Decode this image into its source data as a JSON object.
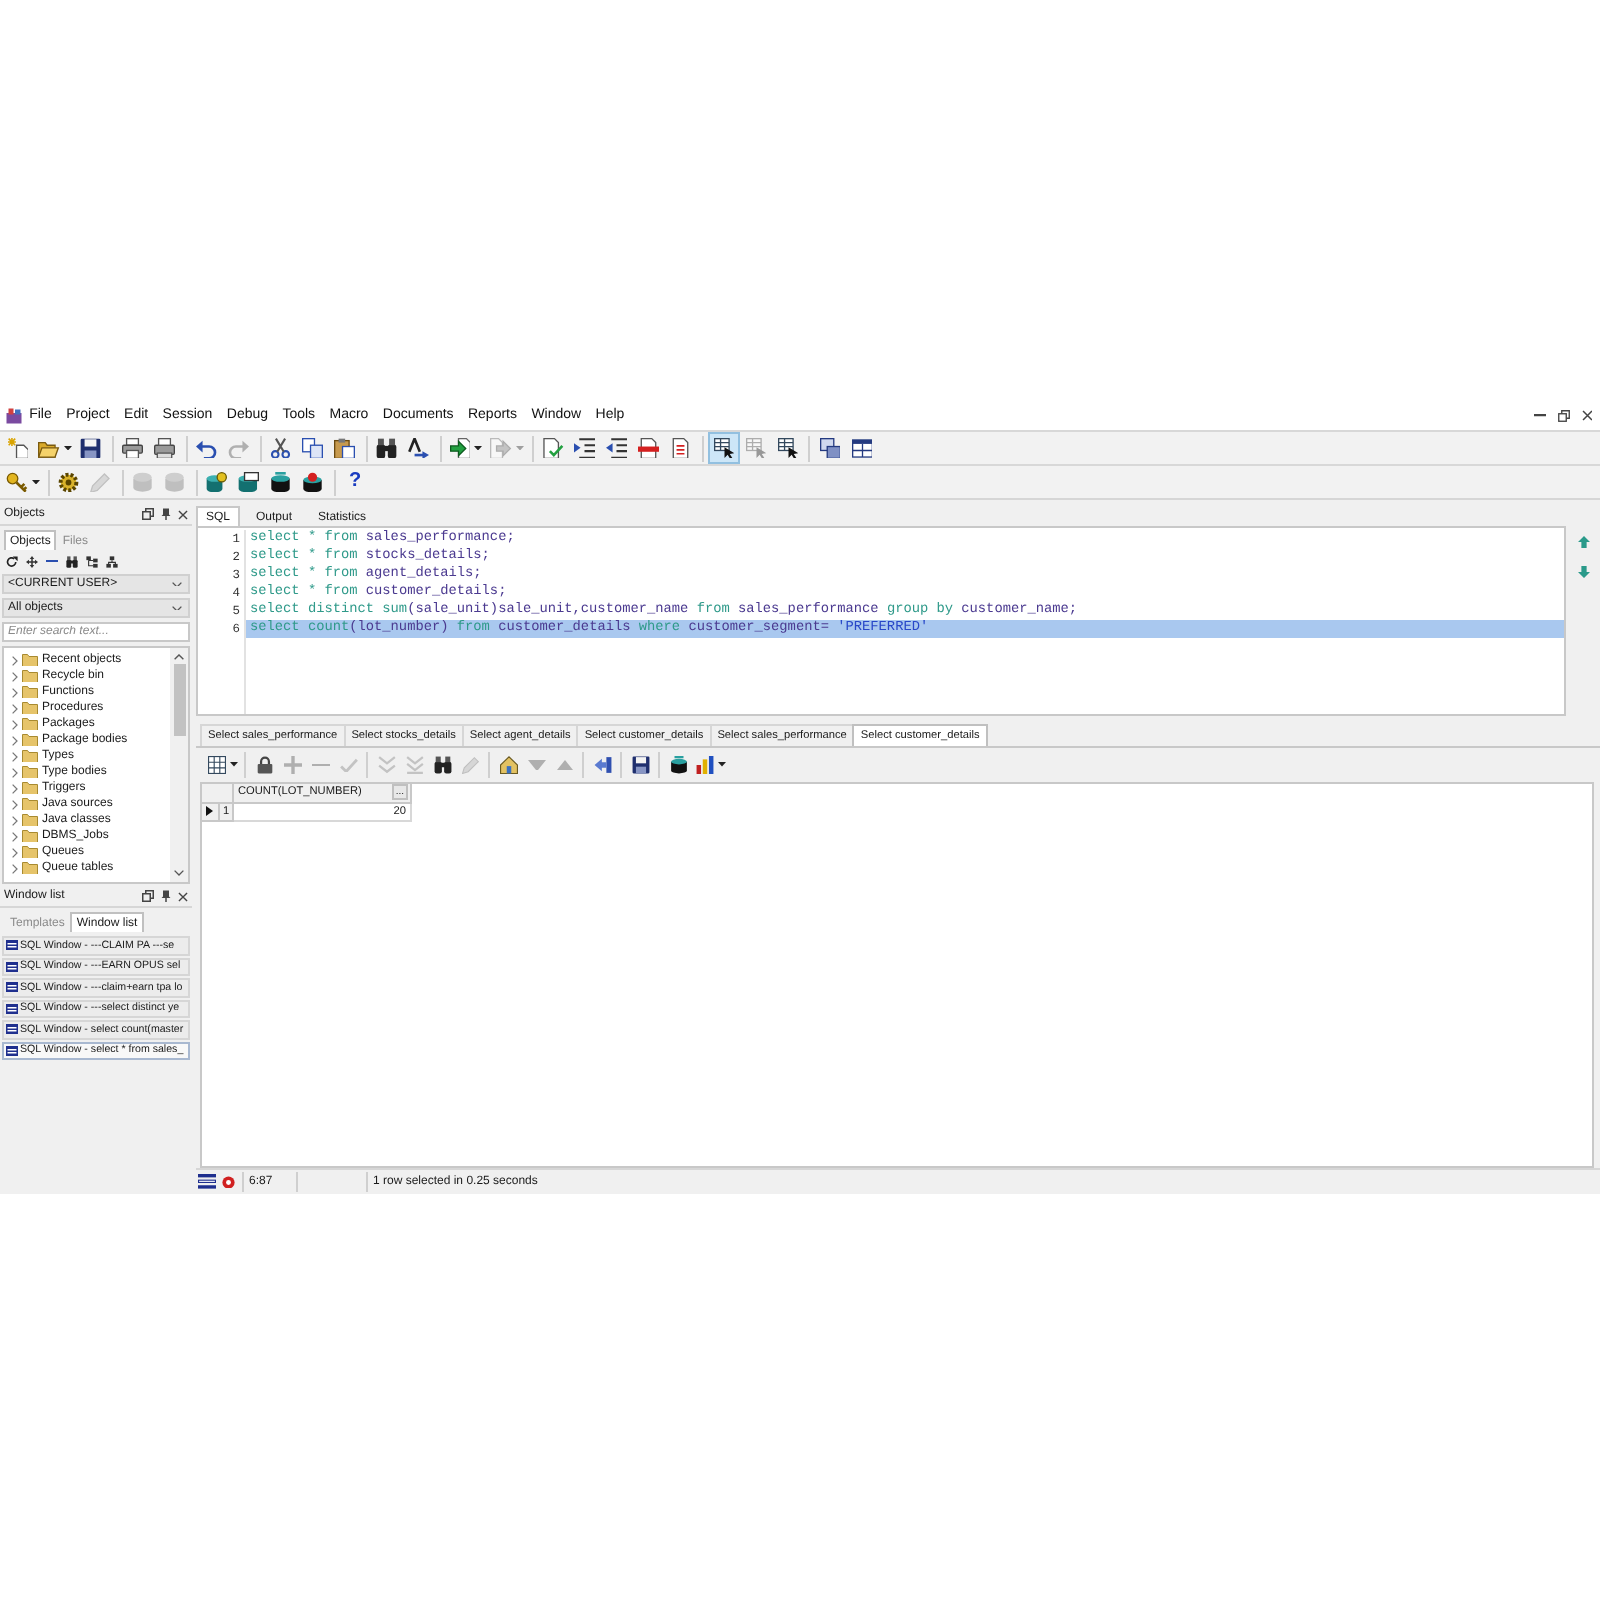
{
  "menu": {
    "items": [
      "File",
      "Project",
      "Edit",
      "Session",
      "Debug",
      "Tools",
      "Macro",
      "Documents",
      "Reports",
      "Window",
      "Help"
    ]
  },
  "toolbar_main": {
    "groups": [
      [
        {
          "kind": "new",
          "disabled": false,
          "dropdown": false,
          "pressed": false
        },
        {
          "kind": "open",
          "disabled": false,
          "dropdown": true,
          "pressed": false
        },
        {
          "kind": "save",
          "disabled": false,
          "dropdown": false,
          "pressed": false
        }
      ],
      [
        {
          "kind": "print",
          "disabled": false,
          "dropdown": false,
          "pressed": false
        },
        {
          "kind": "preview",
          "disabled": false,
          "dropdown": false,
          "pressed": false
        }
      ],
      [
        {
          "kind": "undo",
          "disabled": false,
          "dropdown": false,
          "pressed": false
        },
        {
          "kind": "redo",
          "disabled": true,
          "dropdown": false,
          "pressed": false
        }
      ],
      [
        {
          "kind": "cut",
          "disabled": false,
          "dropdown": false,
          "pressed": false
        },
        {
          "kind": "copy",
          "disabled": false,
          "dropdown": false,
          "pressed": false
        },
        {
          "kind": "paste",
          "disabled": false,
          "dropdown": false,
          "pressed": false
        }
      ],
      [
        {
          "kind": "find",
          "disabled": false,
          "dropdown": false,
          "pressed": false
        },
        {
          "kind": "replace",
          "disabled": false,
          "dropdown": false,
          "pressed": false
        }
      ],
      [
        {
          "kind": "execute",
          "disabled": false,
          "dropdown": true,
          "pressed": false
        },
        {
          "kind": "step",
          "disabled": true,
          "dropdown": true,
          "pressed": false
        }
      ],
      [
        {
          "kind": "verify",
          "disabled": false,
          "dropdown": false,
          "pressed": false
        },
        {
          "kind": "indent",
          "disabled": false,
          "dropdown": false,
          "pressed": false
        },
        {
          "kind": "outdent",
          "disabled": false,
          "dropdown": false,
          "pressed": false
        },
        {
          "kind": "comment",
          "disabled": false,
          "dropdown": false,
          "pressed": false
        },
        {
          "kind": "uncomment",
          "disabled": false,
          "dropdown": false,
          "pressed": false
        }
      ],
      [
        {
          "kind": "pointer",
          "disabled": false,
          "dropdown": false,
          "pressed": true
        },
        {
          "kind": "pointer",
          "disabled": true,
          "dropdown": false,
          "pressed": false
        },
        {
          "kind": "pointer",
          "disabled": false,
          "dropdown": false,
          "pressed": false
        }
      ],
      [
        {
          "kind": "cascade",
          "disabled": false,
          "dropdown": false,
          "pressed": false
        },
        {
          "kind": "tile",
          "disabled": false,
          "dropdown": false,
          "pressed": false
        }
      ]
    ]
  },
  "toolbar_secondary": {
    "groups": [
      [
        {
          "kind": "key",
          "disabled": false,
          "dropdown": true,
          "pressed": false
        }
      ],
      [
        {
          "kind": "gear",
          "disabled": false,
          "dropdown": false,
          "pressed": false
        },
        {
          "kind": "pencil",
          "disabled": true,
          "dropdown": false,
          "pressed": false
        }
      ],
      [
        {
          "kind": "commit",
          "disabled": true,
          "dropdown": false,
          "pressed": false
        },
        {
          "kind": "commit",
          "disabled": true,
          "dropdown": false,
          "pressed": false
        }
      ],
      [
        {
          "kind": "dbuser",
          "disabled": false,
          "dropdown": false,
          "pressed": false
        },
        {
          "kind": "dblist",
          "disabled": false,
          "dropdown": false,
          "pressed": false
        },
        {
          "kind": "dbplain",
          "disabled": false,
          "dropdown": false,
          "pressed": false
        },
        {
          "kind": "dbred",
          "disabled": false,
          "dropdown": false,
          "pressed": false
        }
      ],
      [
        {
          "kind": "help",
          "label": "?",
          "disabled": false,
          "dropdown": false,
          "pressed": false
        }
      ]
    ]
  },
  "objects_panel": {
    "title": "Objects",
    "tabs": [
      {
        "label": "Objects",
        "selected": true
      },
      {
        "label": "Files",
        "selected": false
      }
    ],
    "user_filter": "<CURRENT USER>",
    "object_filter": "All objects",
    "search": {
      "placeholder": "Enter search text..."
    },
    "tree": [
      {
        "label": "Recent objects",
        "expanded": false
      },
      {
        "label": "Recycle bin",
        "expanded": false
      },
      {
        "label": "Functions",
        "expanded": false
      },
      {
        "label": "Procedures",
        "expanded": false
      },
      {
        "label": "Packages",
        "expanded": false
      },
      {
        "label": "Package bodies",
        "expanded": false
      },
      {
        "label": "Types",
        "expanded": false
      },
      {
        "label": "Type bodies",
        "expanded": false
      },
      {
        "label": "Triggers",
        "expanded": false
      },
      {
        "label": "Java sources",
        "expanded": false
      },
      {
        "label": "Java classes",
        "expanded": false
      },
      {
        "label": "DBMS_Jobs",
        "expanded": false
      },
      {
        "label": "Queues",
        "expanded": false
      },
      {
        "label": "Queue tables",
        "expanded": false
      }
    ]
  },
  "window_list": {
    "title": "Window list",
    "tabs": [
      {
        "label": "Templates",
        "selected": false
      },
      {
        "label": "Window list",
        "selected": true
      }
    ],
    "items": [
      {
        "label": "SQL Window - ---CLAIM PA ---se",
        "selected": false
      },
      {
        "label": "SQL Window - ---EARN OPUS sel",
        "selected": false
      },
      {
        "label": "SQL Window - ---claim+earn tpa lo",
        "selected": false
      },
      {
        "label": "SQL Window - ---select distinct ye",
        "selected": false
      },
      {
        "label": "SQL Window - select count(master",
        "selected": false
      },
      {
        "label": "SQL Window - select * from sales_",
        "selected": true
      }
    ]
  },
  "editor": {
    "tabs": [
      {
        "label": "SQL",
        "selected": true
      },
      {
        "label": "Output",
        "selected": false
      },
      {
        "label": "Statistics",
        "selected": false
      }
    ],
    "lines": [
      {
        "number": "1",
        "selected": false,
        "tokens": [
          {
            "kind": "keyword",
            "text": "select * from "
          },
          {
            "kind": "identifier",
            "text": "sales_performance;"
          }
        ]
      },
      {
        "number": "2",
        "selected": false,
        "tokens": [
          {
            "kind": "keyword",
            "text": "select * from "
          },
          {
            "kind": "identifier",
            "text": "stocks_details;"
          }
        ]
      },
      {
        "number": "3",
        "selected": false,
        "tokens": [
          {
            "kind": "keyword",
            "text": "select * from "
          },
          {
            "kind": "identifier",
            "text": "agent_details;"
          }
        ]
      },
      {
        "number": "4",
        "selected": false,
        "tokens": [
          {
            "kind": "keyword",
            "text": "select * from "
          },
          {
            "kind": "identifier",
            "text": "customer_details;"
          }
        ]
      },
      {
        "number": "5",
        "selected": false,
        "tokens": [
          {
            "kind": "keyword",
            "text": "select distinct sum"
          },
          {
            "kind": "identifier",
            "text": "(sale_unit)sale_unit,customer_name "
          },
          {
            "kind": "keyword",
            "text": "from "
          },
          {
            "kind": "identifier",
            "text": "sales_performance "
          },
          {
            "kind": "keyword",
            "text": "group by "
          },
          {
            "kind": "identifier",
            "text": "customer_name;"
          }
        ]
      },
      {
        "number": "6",
        "selected": true,
        "tokens": [
          {
            "kind": "keyword",
            "text": "select count"
          },
          {
            "kind": "identifier",
            "text": "(lot_number) "
          },
          {
            "kind": "keyword",
            "text": "from "
          },
          {
            "kind": "identifier",
            "text": "customer_details "
          },
          {
            "kind": "keyword",
            "text": "where "
          },
          {
            "kind": "identifier",
            "text": "customer_segment= "
          },
          {
            "kind": "string",
            "text": "'PREFERRED'"
          }
        ]
      }
    ]
  },
  "results": {
    "tabs": [
      {
        "label": "Select sales_performance",
        "selected": false
      },
      {
        "label": "Select stocks_details",
        "selected": false
      },
      {
        "label": "Select agent_details",
        "selected": false
      },
      {
        "label": "Select customer_details",
        "selected": false
      },
      {
        "label": "Select sales_performance",
        "selected": false
      },
      {
        "label": "Select customer_details",
        "selected": true
      }
    ],
    "toolbar": {
      "groups": [
        [
          {
            "kind": "grid",
            "disabled": false,
            "dropdown": true,
            "pressed": false
          }
        ],
        [
          {
            "kind": "lock",
            "disabled": false,
            "dropdown": false,
            "pressed": false
          },
          {
            "kind": "add",
            "disabled": true,
            "dropdown": false,
            "pressed": false
          },
          {
            "kind": "remove",
            "disabled": true,
            "dropdown": false,
            "pressed": false
          },
          {
            "kind": "accept",
            "disabled": true,
            "dropdown": false,
            "pressed": false
          }
        ],
        [
          {
            "kind": "next",
            "disabled": true,
            "dropdown": false,
            "pressed": false
          },
          {
            "kind": "last",
            "disabled": true,
            "dropdown": false,
            "pressed": false
          },
          {
            "kind": "find",
            "disabled": false,
            "dropdown": false,
            "pressed": false
          },
          {
            "kind": "pencil",
            "disabled": true,
            "dropdown": false,
            "pressed": false
          }
        ],
        [
          {
            "kind": "query",
            "disabled": false,
            "dropdown": false,
            "pressed": false
          },
          {
            "kind": "filterdown",
            "disabled": true,
            "dropdown": false,
            "pressed": false
          },
          {
            "kind": "filterup",
            "disabled": true,
            "dropdown": false,
            "pressed": false
          }
        ],
        [
          {
            "kind": "export",
            "disabled": false,
            "dropdown": false,
            "pressed": false
          }
        ],
        [
          {
            "kind": "save",
            "disabled": false,
            "dropdown": false,
            "pressed": false
          }
        ],
        [
          {
            "kind": "dbplain",
            "disabled": false,
            "dropdown": false,
            "pressed": false
          },
          {
            "kind": "chart",
            "disabled": false,
            "dropdown": true,
            "pressed": false
          }
        ]
      ]
    },
    "grid": {
      "columns": [
        {
          "label": "COUNT(LOT_NUMBER)",
          "button": "..."
        }
      ],
      "rows": [
        {
          "number": "1",
          "current": true,
          "cells": [
            "20"
          ]
        }
      ]
    }
  },
  "status_bar": {
    "position": "6:87",
    "message": "1 row selected in 0.25 seconds"
  }
}
